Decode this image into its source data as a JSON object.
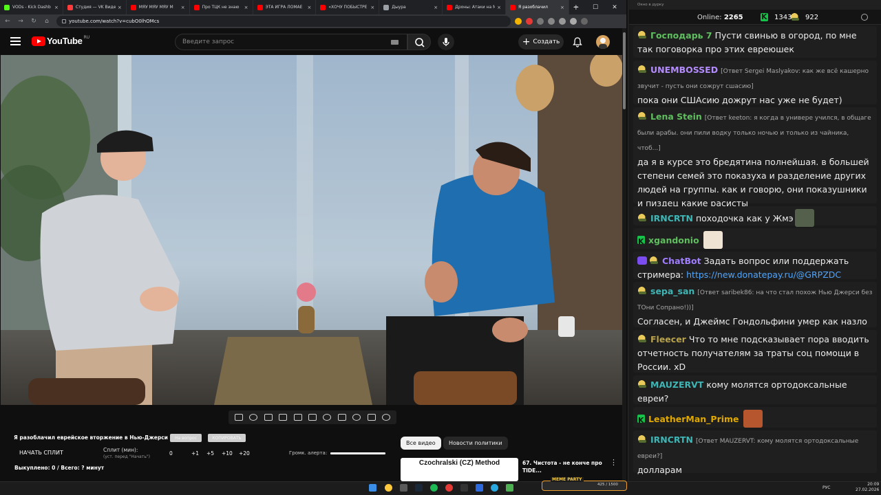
{
  "browser": {
    "tabs": [
      {
        "label": "VODs - Kick Dashb",
        "color": "#53fc18"
      },
      {
        "label": "Студия — VK Видео",
        "color": "#ff3b3b"
      },
      {
        "label": "МЯУ МЯУ МЯУ М",
        "color": "#ff0000"
      },
      {
        "label": "Про ТЦК не знаю",
        "color": "#ff0000"
      },
      {
        "label": "ЭТА ИГРА ЛОМАЕ",
        "color": "#ff0000"
      },
      {
        "label": "«ХОЧУ ПОБЫСТРЕ",
        "color": "#ff0000"
      },
      {
        "label": "Дыура",
        "color": "#9aa0a6"
      },
      {
        "label": "Дроны: Атаки на М",
        "color": "#ff0000"
      },
      {
        "label": "Я разоблачил",
        "color": "#ff0000"
      }
    ],
    "url": "youtube.com/watch?v=cubO0lhOMcs"
  },
  "youtube": {
    "logo_text": "YouTube",
    "region": "RU",
    "search_placeholder": "Введите запрос",
    "create_label": "Создать"
  },
  "split_panel": {
    "title": "Я разоблачил еврейское вторжение в Нью-Джерси...",
    "pill_1": "На вопрос",
    "pill_2": "КОПИРОВАТЬ",
    "start_label": "НАЧАТЬ СПЛИТ",
    "split_min_label": "Сплит (мин):",
    "split_min_sub": "(уст. перед \"Начать\")",
    "values": [
      "0",
      "+1",
      "+5",
      "+10",
      "+20"
    ],
    "volume_label": "Громк. алерта:",
    "volume_level": 1.0,
    "bought": "Выкуплено: 0 / Всего: ? минут"
  },
  "recommendations": {
    "chips": [
      "Все видео",
      "Новости политики"
    ],
    "video_thumb_title": "Czochralski (CZ) Method",
    "video_title": "67. Чистота - не конче про TIDE..."
  },
  "chat": {
    "window_title": "Окно в дурку",
    "online_label": "Online:",
    "online_count": "2265",
    "k_count": "1343",
    "p_count": "922",
    "messages": [
      {
        "badge": "pepe",
        "nick": "Господарь 7",
        "color": "#5fbf5f",
        "reply": "",
        "text": "Пусти свинью в огород, по мне так поговорка про этих евреюшек"
      },
      {
        "badge": "pepe",
        "nick": "UNEMBOSSED",
        "color": "#b48cff",
        "reply": "[Ответ Sergei Maslyakov: как же всё кашерно звучит - пусть они сожрут сшасию]",
        "text": "пока они СШАсию дожрут нас уже не будет)"
      },
      {
        "badge": "pepe",
        "nick": "Lena Stein",
        "color": "#5fbf5f",
        "reply": "[Ответ keeton: я когда в универе учился, в общаге были арабы. они пили водку только ночью и только из чайника, чтоб...]",
        "text": "да я в курсе это бредятина полнейшая. в большей степени семей это показуха и разделение других людей на группы. как и говорю, они показушники и пиздец какие расисты"
      },
      {
        "badge": "pepe",
        "nick": "IRNCRTN",
        "color": "#3fb6b6",
        "reply": "",
        "text": "походочка как у Жмэ"
      },
      {
        "badge": "k",
        "nick": "xgandonio",
        "color": "#5fbf5f",
        "reply": "",
        "text": ""
      },
      {
        "badge": "bot",
        "nick": "ChatBot",
        "color": "#a07cff",
        "reply": "",
        "text": "Задать вопрос или поддержать стримера:",
        "link": "https://new.donatepay.ru/@GRPZDC"
      },
      {
        "badge": "pepe",
        "nick": "sepa_san",
        "color": "#3fb6b6",
        "reply": "[Ответ saribek86: на что стал похож Нью Джерси без ТОни Сопрано!))]",
        "text": "Согласен, и Джеймс Гондольфини умер как назло"
      },
      {
        "badge": "pepe",
        "nick": "Fleecer",
        "color": "#b8a24a",
        "reply": "",
        "text": "Что то мне подсказывает пора вводить отчетность получателям за траты соц помощи в России. xD"
      },
      {
        "badge": "pepe",
        "nick": "MAUZERVT",
        "color": "#3fb6b6",
        "reply": "",
        "text": "кому молятся ортодоксальные евреи?"
      },
      {
        "badge": "k",
        "nick": "LeatherMan_Prime",
        "color": "#e0a800",
        "reply": "",
        "text": ""
      },
      {
        "badge": "pepe",
        "nick": "IRNCRTN",
        "color": "#3fb6b6",
        "reply": "[Ответ MAUZERVT: кому молятся ортодоксальные евреи?]",
        "text": "долларам"
      }
    ]
  },
  "taskbar": {
    "meme_title": "MEME PARTY",
    "meme_count": "425 / 1500",
    "lang": "РУС",
    "time": "20:09",
    "date": "27.02.2026"
  }
}
